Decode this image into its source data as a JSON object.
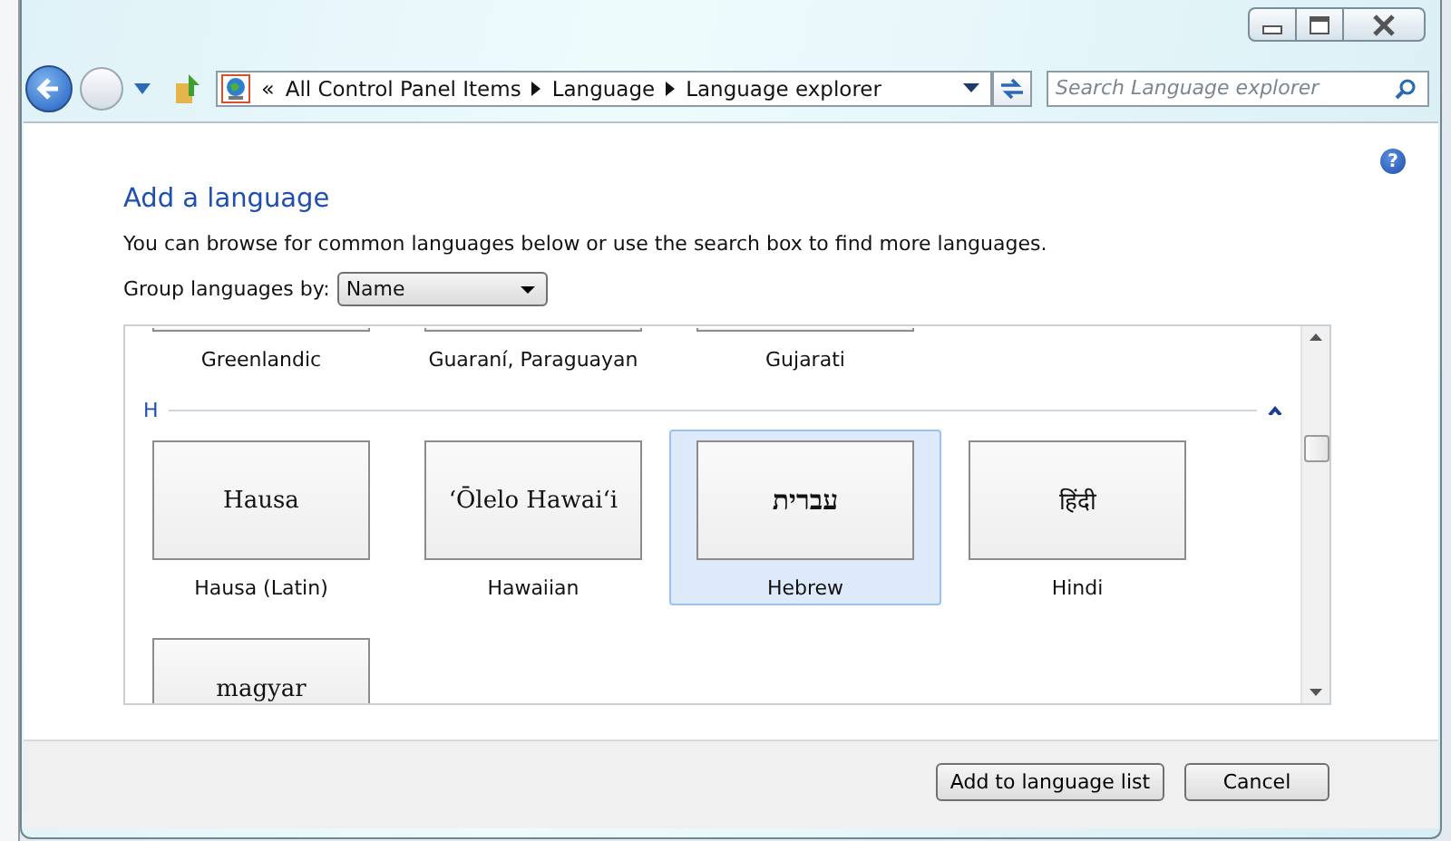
{
  "window": {
    "controls": [
      {
        "kind": "minimize"
      },
      {
        "kind": "maximize"
      },
      {
        "kind": "close"
      }
    ]
  },
  "navigation": {
    "overflow": "«",
    "breadcrumbs": [
      "All Control Panel Items",
      "Language",
      "Language explorer"
    ],
    "search": {
      "placeholder": "Search Language explorer"
    }
  },
  "help": "?",
  "heading": "Add a language",
  "description": "You can browse for common languages below or use the search box to find more languages.",
  "group_by": {
    "label": "Group languages by:",
    "value": "Name"
  },
  "groups": [
    {
      "items": [
        {
          "name": "Greenlandic",
          "selected": false
        },
        {
          "name": "Guaraní, Paraguayan",
          "selected": false
        },
        {
          "name": "Gujarati",
          "selected": false
        }
      ]
    },
    {
      "letter": "H",
      "expanded": true,
      "items": [
        {
          "sample": "Hausa",
          "name": "Hausa (Latin)",
          "selected": false
        },
        {
          "sample": "ʻŌlelo Hawaiʻi",
          "name": "Hawaiian",
          "selected": false
        },
        {
          "sample": "עברית",
          "name": "Hebrew",
          "selected": true
        },
        {
          "sample": "हिंदी",
          "name": "Hindi",
          "selected": false
        },
        {
          "sample": "magyar",
          "selected": false
        }
      ]
    }
  ],
  "buttons": [
    "Add to language list",
    "Cancel"
  ]
}
